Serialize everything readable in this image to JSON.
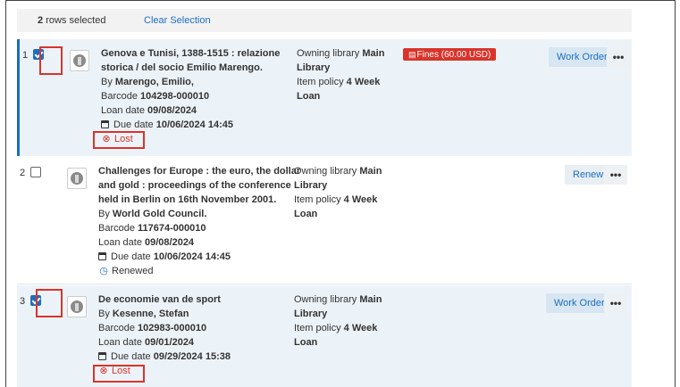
{
  "selection": {
    "count": "2",
    "label": "rows selected",
    "clear": "Clear Selection"
  },
  "rows": [
    {
      "index": "1",
      "checked": true,
      "title_lines": [
        "Genova e Tunisi, 1388-1515 : relazione",
        "storica / del socio Emilio Marengo."
      ],
      "by_prefix": "By",
      "author": "Marengo, Emilio,",
      "barcode_label": "Barcode",
      "barcode": "104298-000010",
      "loan_label": "Loan date",
      "loan_date": "09/08/2024",
      "due_label": "Due date",
      "due_date": "10/06/2024 14:45",
      "status": "Lost",
      "owning_label": "Owning library",
      "owning_value_1": "Main",
      "owning_value_2": "Library",
      "policy_label": "Item policy",
      "policy_value_1": "4 Week",
      "policy_value_2": "Loan",
      "fine": "Fines (60.00 USD)",
      "action": "Work Order",
      "more": "•••"
    },
    {
      "index": "2",
      "checked": false,
      "title_lines": [
        "Challenges for Europe : the euro, the dollar",
        "and gold : proceedings of the conference",
        "held in Berlin on 16th November 2001."
      ],
      "by_prefix": "By",
      "author": "World Gold Council.",
      "barcode_label": "Barcode",
      "barcode": "117674-000010",
      "loan_label": "Loan date",
      "loan_date": "09/08/2024",
      "due_label": "Due date",
      "due_date": "10/06/2024 14:45",
      "status": "Renewed",
      "owning_label": "Owning library",
      "owning_value_1": "Main",
      "owning_value_2": "Library",
      "policy_label": "Item policy",
      "policy_value_1": "4 Week",
      "policy_value_2": "Loan",
      "action": "Renew",
      "more": "•••"
    },
    {
      "index": "3",
      "checked": true,
      "title_lines": [
        "De economie van de sport"
      ],
      "by_prefix": "By",
      "author": "Kesenne, Stefan",
      "barcode_label": "Barcode",
      "barcode": "102983-000010",
      "loan_label": "Loan date",
      "loan_date": "09/01/2024",
      "due_label": "Due date",
      "due_date": "09/29/2024 15:38",
      "status": "Lost",
      "owning_label": "Owning library",
      "owning_value_1": "Main",
      "owning_value_2": "Library",
      "policy_label": "Item policy",
      "policy_value_1": "4 Week",
      "policy_value_2": "Loan",
      "action": "Work Order",
      "more": "•••"
    }
  ],
  "icons": {
    "lost": "x-circle-icon",
    "renewed": "clock-icon",
    "calendar": "calendar-icon",
    "fine": "money-icon"
  },
  "colors": {
    "accent": "#1b6ec2",
    "lost": "#d9342b",
    "selected_bg": "#ecf3f8"
  }
}
